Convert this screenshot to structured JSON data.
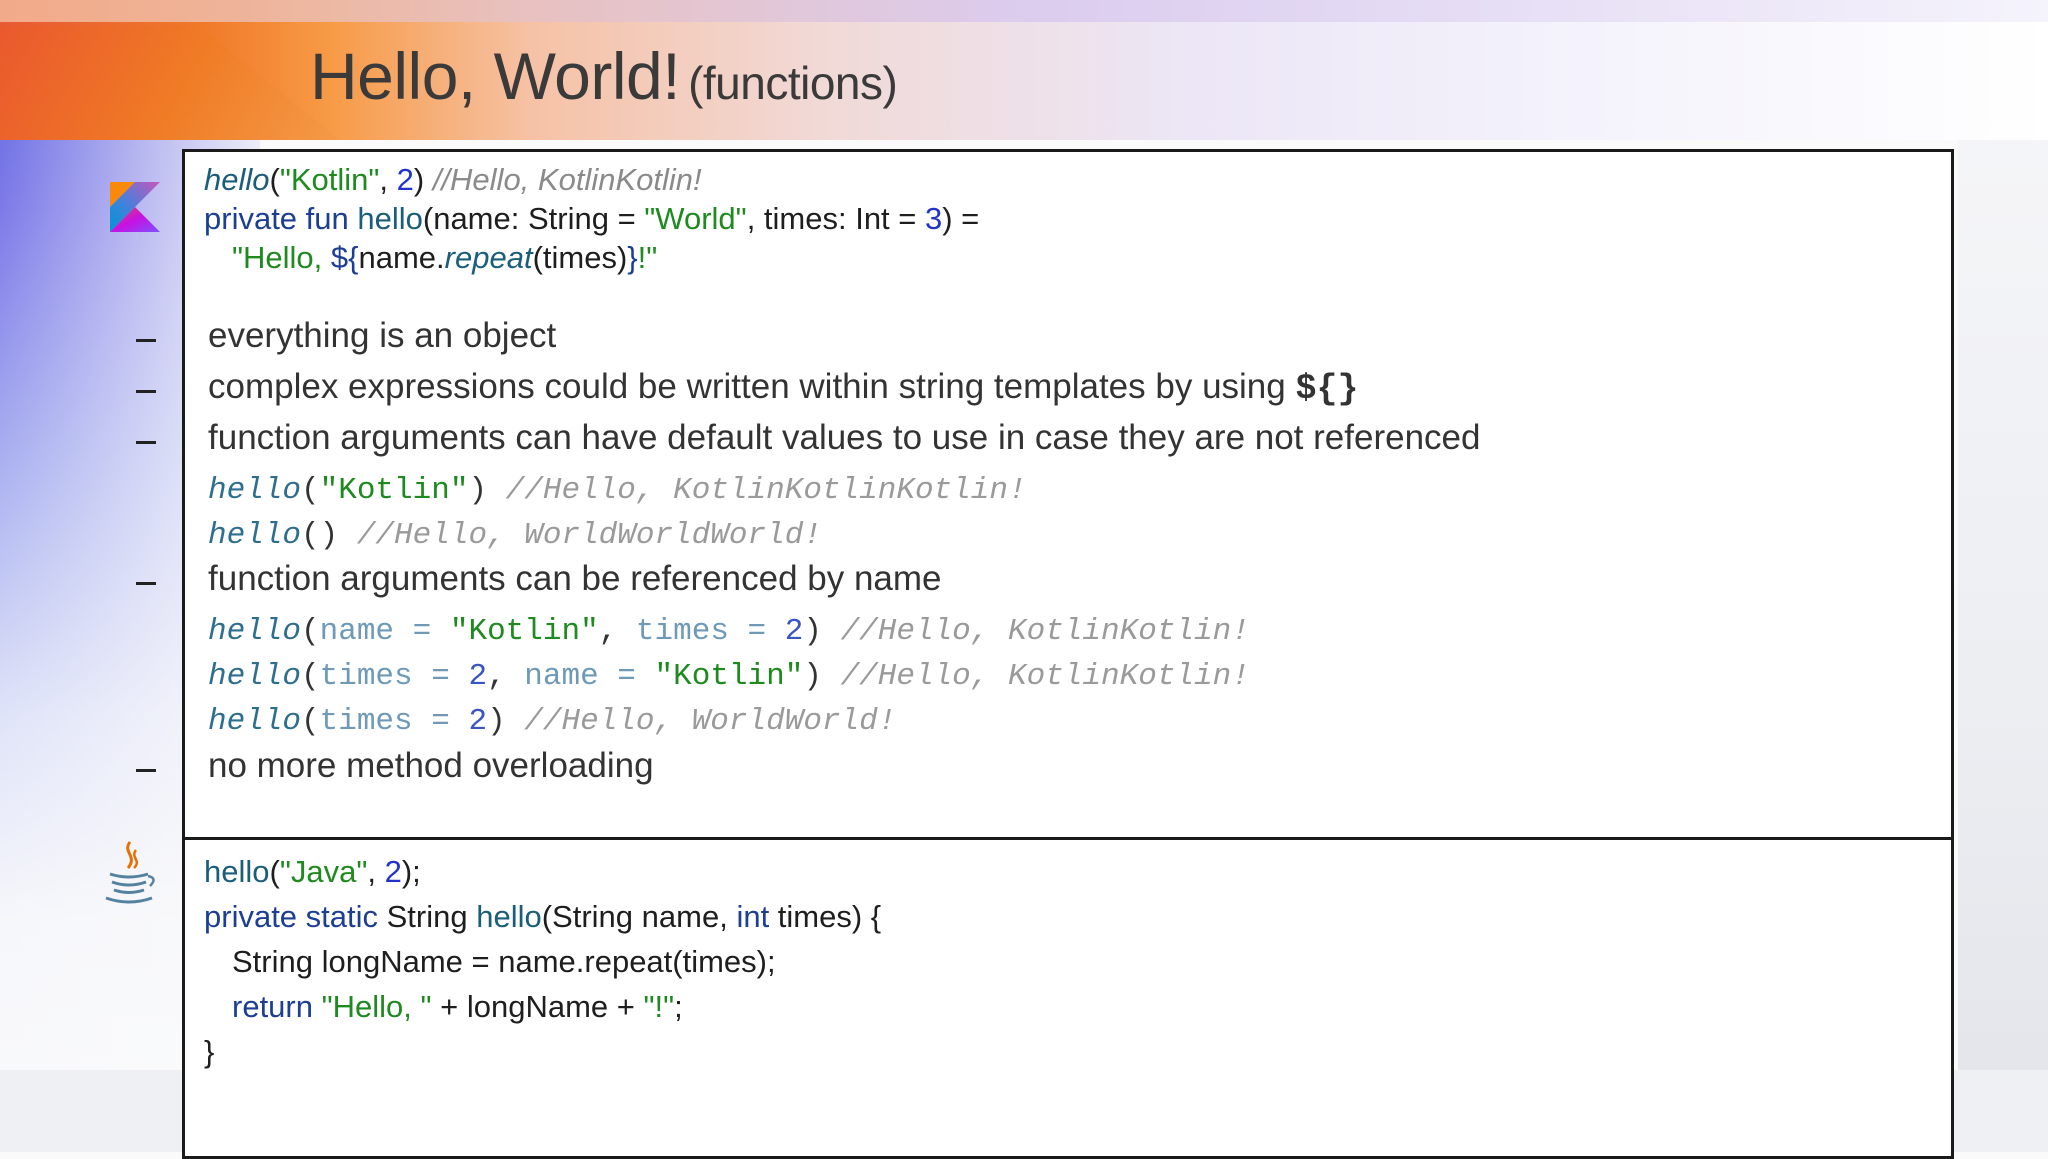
{
  "slide": {
    "title": "Hello, World!",
    "subtitle": "(functions)"
  },
  "kotlin_example": {
    "line1": {
      "fn": "hello",
      "open": "(",
      "str": "\"Kotlin\"",
      "comma": ", ",
      "num": "2",
      "close": ") ",
      "comment": "//Hello, KotlinKotlin!"
    },
    "line2": {
      "kw": "private fun ",
      "fn": "hello",
      "a": "(name: String = ",
      "str": "\"World\"",
      "b": ", times: Int = ",
      "num": "3",
      "c": ") ="
    },
    "line3": {
      "str1": "\"Hello, ",
      "tmpl_open": "${",
      "name": "name.",
      "repeat": "repeat",
      "args": "(times)",
      "tmpl_close": "}",
      "str2": "!\""
    }
  },
  "bullets": {
    "b1": "everything is an object",
    "b2": "complex expressions could be written within string templates by using ",
    "b2_code": "${}",
    "b3": "function arguments can have default values to use in case they are not referenced",
    "b4": "function arguments can be referenced by name",
    "b5": "no more method overloading",
    "dash": "-"
  },
  "examples": {
    "e1": {
      "fn": "hello",
      "open": "(",
      "str": "\"Kotlin\"",
      "close": ") ",
      "comment": "//Hello, KotlinKotlinKotlin!"
    },
    "e2": {
      "fn": "hello",
      "parens": "() ",
      "comment": "//Hello, WorldWorldWorld!"
    },
    "e3": {
      "fn": "hello",
      "open": "(",
      "p1": "name = ",
      "str": "\"Kotlin\"",
      "comma": ", ",
      "p2": "times = ",
      "num": "2",
      "close": ") ",
      "comment": "//Hello, KotlinKotlin!"
    },
    "e4": {
      "fn": "hello",
      "open": "(",
      "p1": "times = ",
      "num": "2",
      "comma": ", ",
      "p2": "name = ",
      "str": "\"Kotlin\"",
      "close": ") ",
      "comment": "//Hello, KotlinKotlin!"
    },
    "e5": {
      "fn": "hello",
      "open": "(",
      "p1": "times = ",
      "num": "2",
      "close": ") ",
      "comment": "//Hello, WorldWorld!"
    }
  },
  "java_example": {
    "line1": {
      "fn": "hello",
      "open": "(",
      "str": "\"Java\"",
      "comma": ", ",
      "num": "2",
      "close": ");"
    },
    "line2": {
      "kw": "private static ",
      "type": "String ",
      "fn": "hello",
      "a": "(String name, ",
      "kw2": "int",
      "b": " times) {"
    },
    "line3": "String longName = name.repeat(times);",
    "line4": {
      "kw": "return ",
      "str1": "\"Hello, \"",
      "mid": " + longName + ",
      "str2": "\"!\"",
      "end": ";"
    },
    "line5": "}"
  },
  "icons": {
    "kotlin": "kotlin-logo-icon",
    "java": "java-coffee-cup-icon"
  }
}
